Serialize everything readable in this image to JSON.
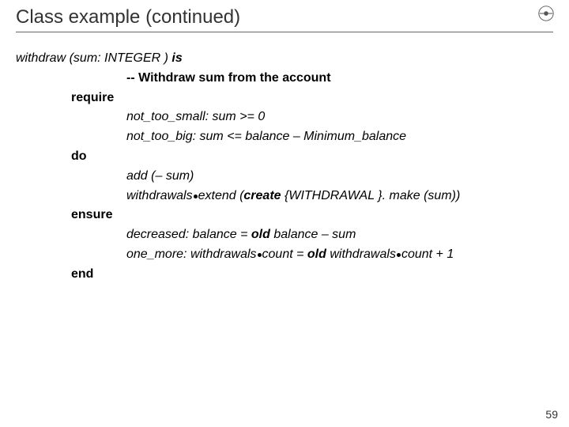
{
  "page": {
    "title": "Class example (continued)",
    "number": "59"
  },
  "code": {
    "sig_name": "withdraw",
    "sig_open": " (",
    "sig_param": "sum",
    "sig_colon": ": ",
    "sig_type": "INTEGER",
    "sig_close": " ) ",
    "sig_is": "is",
    "comment": "-- Withdraw sum from the account",
    "kw_require": "require",
    "req1_tag": "not_too_small",
    "req1_sep": ": ",
    "req1_expr": "sum >= 0",
    "req2_tag": "not_too_big",
    "req2_sep": ": ",
    "req2_expr": "sum <= balance – Minimum_balance",
    "kw_do": "do",
    "do1": "add  (– sum)",
    "do2_a": "withdrawals",
    "do2_b": "extend  (",
    "do2_create": "create",
    "do2_c": " {",
    "do2_class": "WITHDRAWAL",
    "do2_d": " }. ",
    "do2_e": "make  (sum))",
    "kw_ensure": "ensure",
    "ens1_tag": "decreased",
    "ens1_sep": ": ",
    "ens1_a": "balance  = ",
    "ens1_old": "old",
    "ens1_b": " balance – sum",
    "ens2_tag": "one_more",
    "ens2_sep": ": ",
    "ens2_a": "withdrawals",
    "ens2_b": "count  = ",
    "ens2_old": "old",
    "ens2_c": " withdrawals",
    "ens2_d": "count + 1",
    "kw_end": "end"
  }
}
